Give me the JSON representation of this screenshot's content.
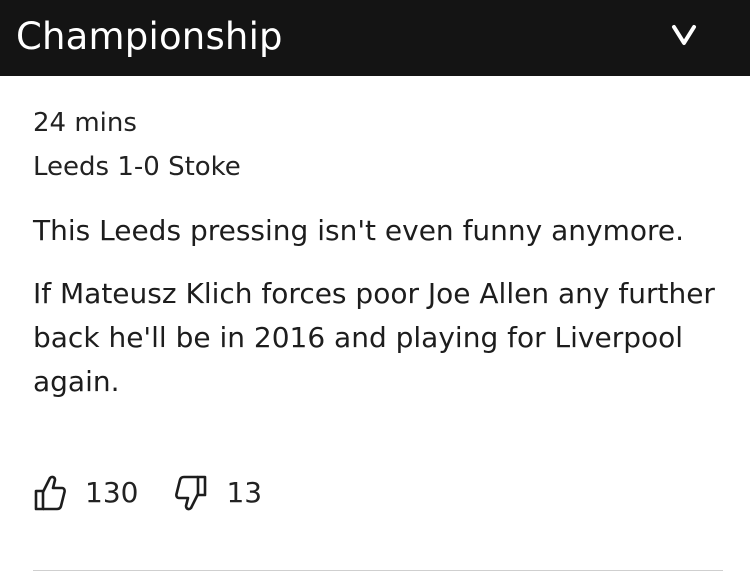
{
  "header": {
    "title": "Championship",
    "toggle_icon": "chevron-down-icon",
    "background": "#141414"
  },
  "post": {
    "time": "24 mins",
    "score": "Leeds 1-0 Stoke",
    "paragraphs": [
      "This Leeds pressing isn't even funny anymore.",
      "If Mateusz Klich forces poor Joe Allen any further back he'll be in 2016 and playing for Liverpool again."
    ]
  },
  "reactions": {
    "like": {
      "icon": "thumbs-up-icon",
      "count": "130"
    },
    "dislike": {
      "icon": "thumbs-down-icon",
      "count": "13"
    }
  }
}
